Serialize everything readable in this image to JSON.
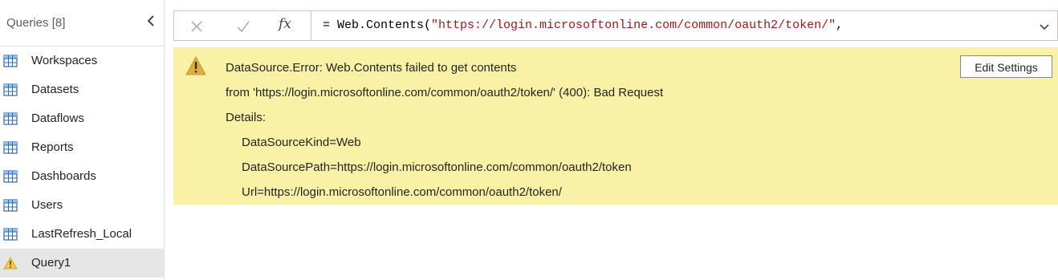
{
  "queries": {
    "title": "Queries [8]",
    "items": [
      {
        "label": "Workspaces",
        "icon": "table-icon",
        "selected": false
      },
      {
        "label": "Datasets",
        "icon": "table-icon",
        "selected": false
      },
      {
        "label": "Dataflows",
        "icon": "table-icon",
        "selected": false
      },
      {
        "label": "Reports",
        "icon": "table-icon",
        "selected": false
      },
      {
        "label": "Dashboards",
        "icon": "table-icon",
        "selected": false
      },
      {
        "label": "Users",
        "icon": "table-icon",
        "selected": false
      },
      {
        "label": "LastRefresh_Local",
        "icon": "table-icon",
        "selected": false
      },
      {
        "label": "Query1",
        "icon": "warning-icon",
        "selected": true
      }
    ]
  },
  "formula_bar": {
    "prefix": "= Web.Contents(",
    "string": "\"https://login.microsoftonline.com/common/oauth2/token/\"",
    "suffix": ",",
    "fx_label": "fx"
  },
  "error": {
    "lines": [
      "DataSource.Error: Web.Contents failed to get contents",
      "from 'https://login.microsoftonline.com/common/oauth2/token/' (400): Bad Request",
      "Details:"
    ],
    "details": [
      "DataSourceKind=Web",
      "DataSourcePath=https://login.microsoftonline.com/common/oauth2/token",
      "Url=https://login.microsoftonline.com/common/oauth2/token/"
    ],
    "edit_settings_label": "Edit Settings"
  },
  "colors": {
    "error_background": "#f9f1a5",
    "warning_icon": "#d6a92c",
    "string_literal": "#a31515",
    "table_icon": "#2b6cb0"
  }
}
